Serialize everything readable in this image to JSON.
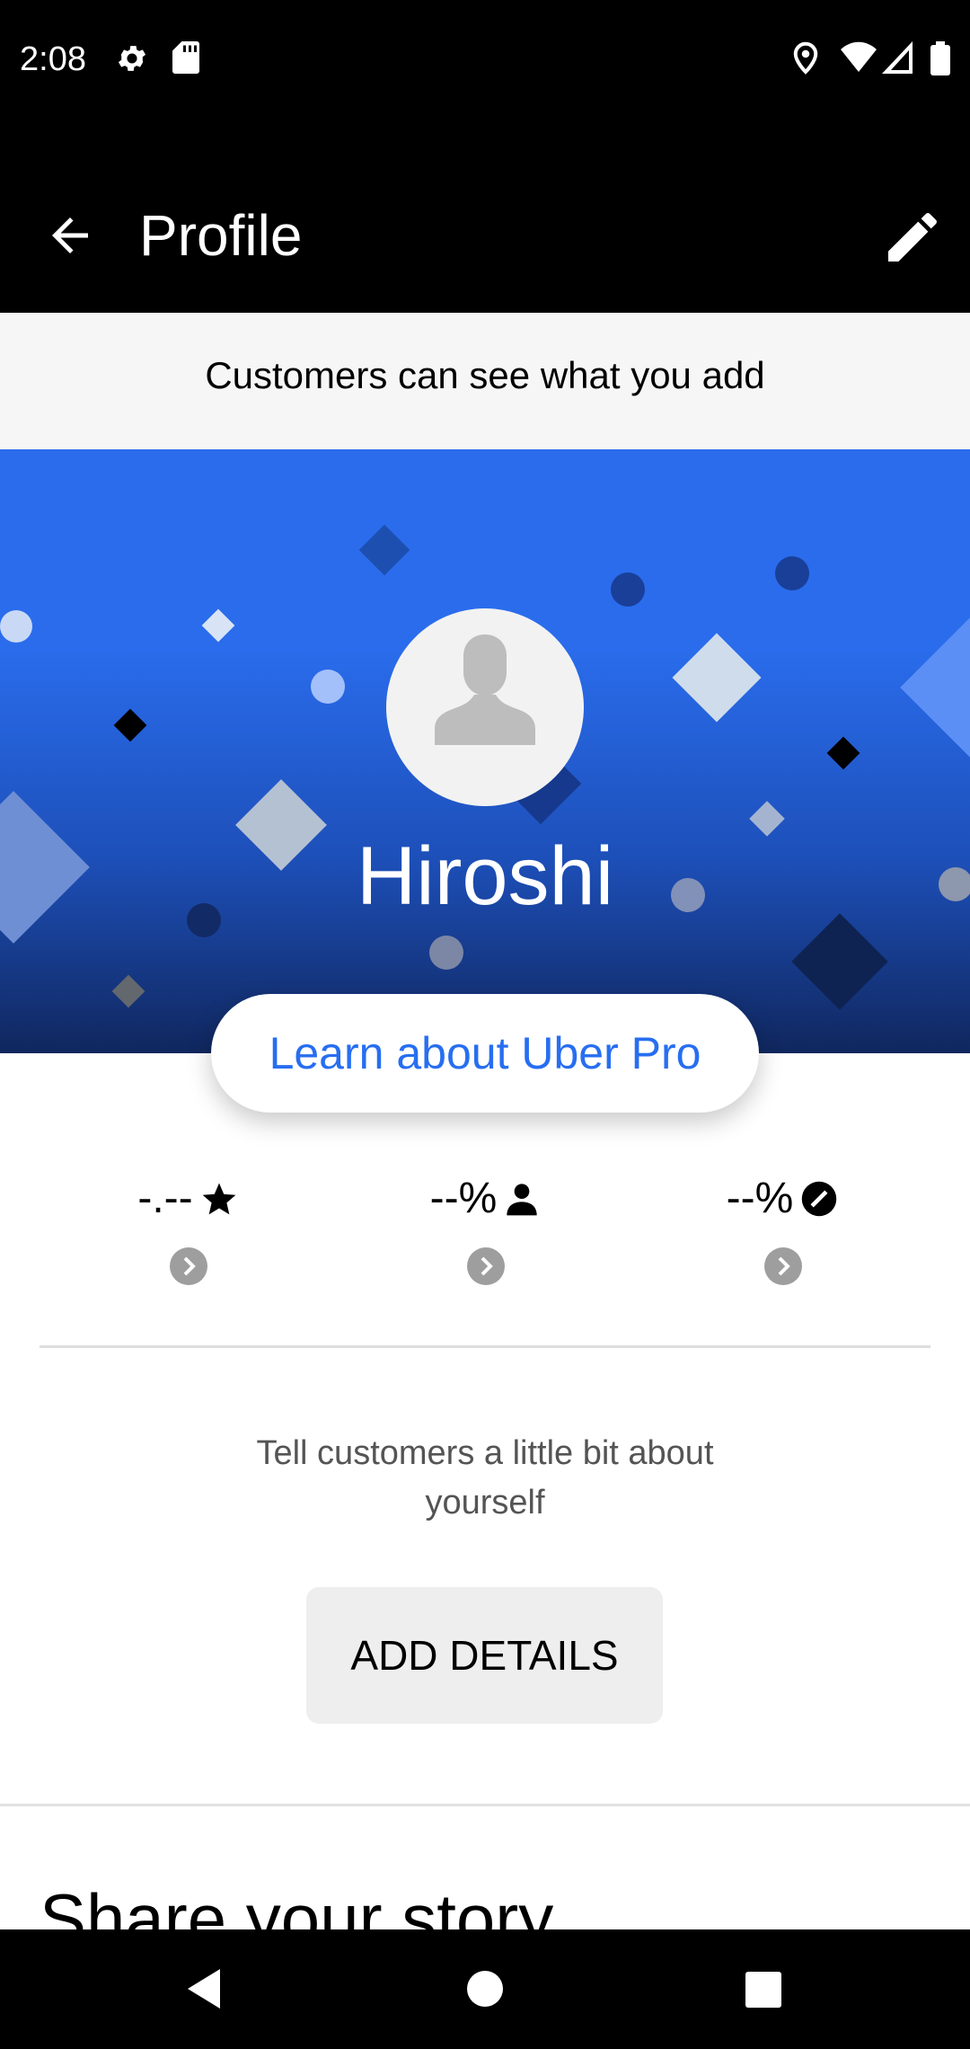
{
  "status_bar": {
    "time": "2:08",
    "icons": [
      "gear-icon",
      "sd-card-icon",
      "location-icon",
      "wifi-icon",
      "signal-icon",
      "battery-icon"
    ]
  },
  "app_bar": {
    "title": "Profile",
    "back_icon": "arrow-left-icon",
    "edit_icon": "pencil-icon"
  },
  "notice": {
    "text": "Customers can see what you add"
  },
  "hero": {
    "name": "Hiroshi",
    "avatar_icon": "person-silhouette-icon",
    "colors": {
      "top": "#2a6cec",
      "bottom": "#10275e"
    }
  },
  "uber_pro": {
    "label": "Learn about Uber Pro",
    "color": "#276ef1"
  },
  "stats": [
    {
      "value": "-.--",
      "icon": "star-icon"
    },
    {
      "value": "--%",
      "icon": "person-icon"
    },
    {
      "value": "--%",
      "icon": "cancel-circle-icon"
    }
  ],
  "about": {
    "prompt": "Tell customers a little bit about yourself",
    "button_label": "ADD DETAILS"
  },
  "story": {
    "heading": "Share your story"
  },
  "nav_bar": {
    "icons": [
      "back-triangle-icon",
      "home-circle-icon",
      "recents-square-icon"
    ]
  }
}
